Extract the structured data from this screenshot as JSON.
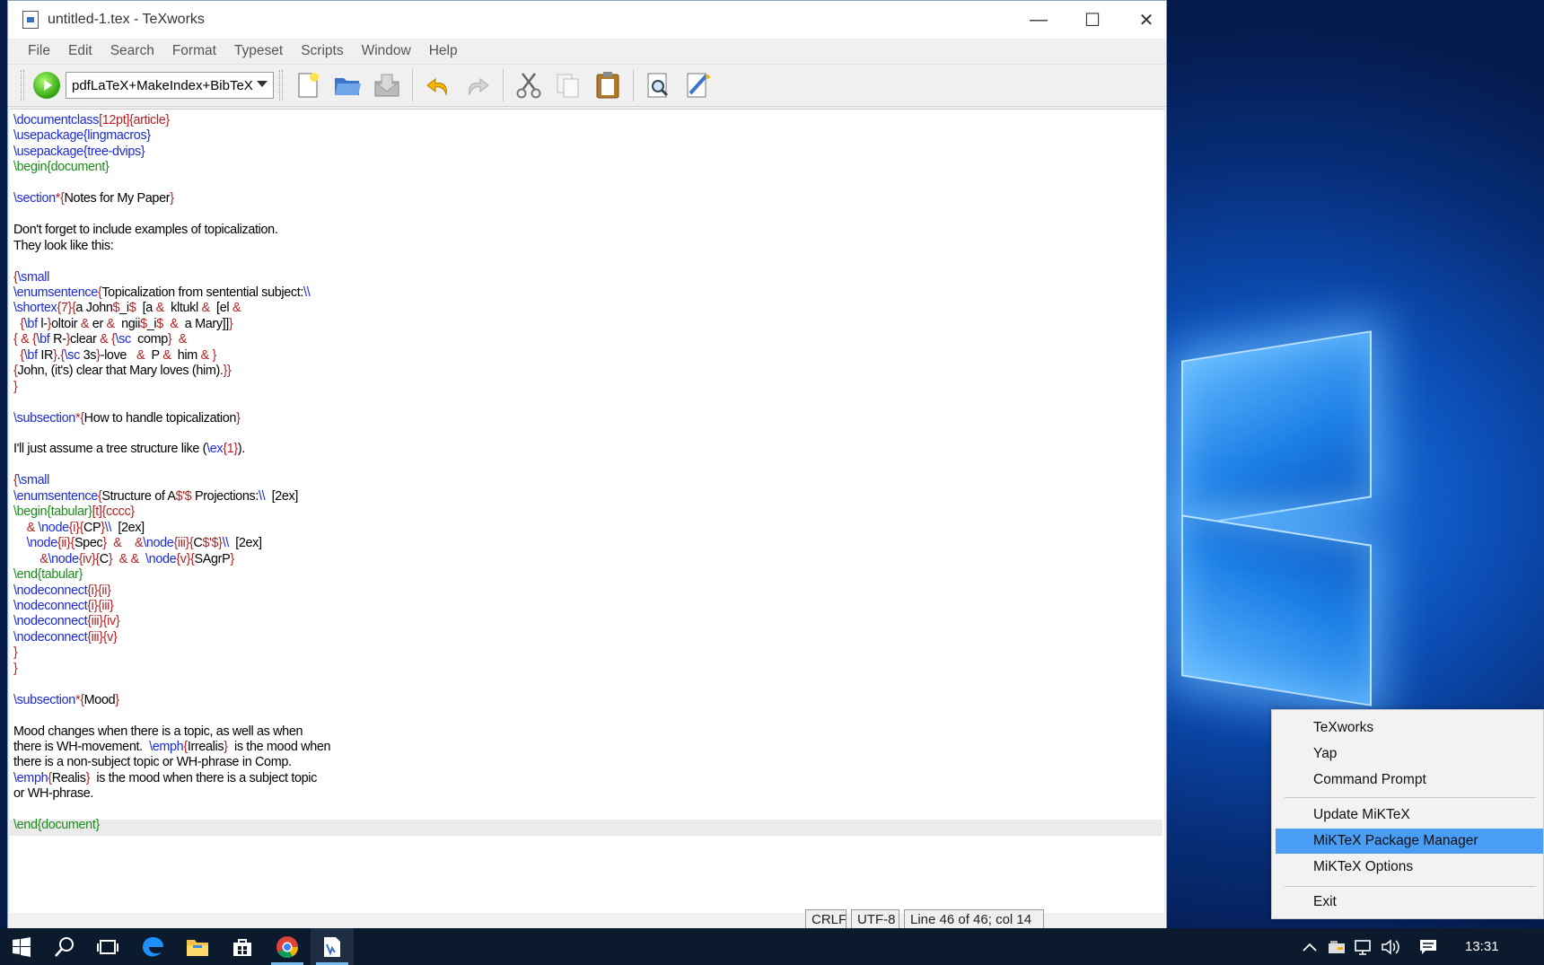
{
  "window": {
    "title": "untitled-1.tex - TeXworks",
    "controls": {
      "minimize": "—",
      "maximize": "☐",
      "close": "✕"
    }
  },
  "menubar": [
    "File",
    "Edit",
    "Search",
    "Format",
    "Typeset",
    "Scripts",
    "Window",
    "Help"
  ],
  "toolbar": {
    "engine": "pdfLaTeX+MakeIndex+BibTeX",
    "icons": [
      "new-file-icon",
      "open-folder-icon",
      "save-icon",
      "undo-icon",
      "redo-icon",
      "cut-icon",
      "copy-icon",
      "paste-icon",
      "find-icon",
      "replace-icon"
    ]
  },
  "editor": {
    "lines": [
      [
        [
          "b",
          "\\documentclass"
        ],
        [
          "r",
          "[12pt]{article}"
        ]
      ],
      [
        [
          "b",
          "\\usepackage"
        ],
        [
          "b",
          "{lingmacros}"
        ]
      ],
      [
        [
          "b",
          "\\usepackage"
        ],
        [
          "b",
          "{tree-dvips}"
        ]
      ],
      [
        [
          "g",
          "\\begin"
        ],
        [
          "g",
          "{document}"
        ]
      ],
      [],
      [
        [
          "b",
          "\\section"
        ],
        [
          "r",
          "*{"
        ],
        [
          "",
          "Notes for My Paper"
        ],
        [
          "r",
          "}"
        ]
      ],
      [],
      [
        [
          "",
          "Don't forget to include examples of topicalization."
        ]
      ],
      [
        [
          "",
          "They look like this:"
        ]
      ],
      [],
      [
        [
          "r",
          "{"
        ],
        [
          "b",
          "\\small"
        ]
      ],
      [
        [
          "b",
          "\\enumsentence"
        ],
        [
          "r",
          "{"
        ],
        [
          "",
          "Topicalization from sentential subject:"
        ],
        [
          "b",
          "\\\\"
        ]
      ],
      [
        [
          "b",
          "\\shortex"
        ],
        [
          "r",
          "{7}{"
        ],
        [
          "",
          "a John"
        ],
        [
          "r",
          "$"
        ],
        [
          "",
          "_i"
        ],
        [
          "r",
          "$"
        ],
        [
          "",
          "  [a "
        ],
        [
          "r",
          "&"
        ],
        [
          "",
          "  kltukl "
        ],
        [
          "r",
          "&"
        ],
        [
          "",
          "  [el "
        ],
        [
          "r",
          "&"
        ]
      ],
      [
        [
          "",
          "  "
        ],
        [
          "r",
          "{"
        ],
        [
          "b",
          "\\bf"
        ],
        [
          "",
          " l-"
        ],
        [
          "r",
          "}"
        ],
        [
          "",
          "oltoir "
        ],
        [
          "r",
          "&"
        ],
        [
          "",
          " er "
        ],
        [
          "r",
          "&"
        ],
        [
          "",
          "  ngii"
        ],
        [
          "r",
          "$"
        ],
        [
          "",
          "_i"
        ],
        [
          "r",
          "$"
        ],
        [
          "",
          "  "
        ],
        [
          "r",
          "&"
        ],
        [
          "",
          "  a Mary]]"
        ],
        [
          "r",
          "}"
        ]
      ],
      [
        [
          "r",
          "{ & {"
        ],
        [
          "b",
          "\\bf"
        ],
        [
          "",
          " R-"
        ],
        [
          "r",
          "}"
        ],
        [
          "",
          "clear "
        ],
        [
          "r",
          "& {"
        ],
        [
          "b",
          "\\sc"
        ],
        [
          "",
          "  comp"
        ],
        [
          "r",
          "}"
        ],
        [
          "",
          "  "
        ],
        [
          "r",
          "&"
        ]
      ],
      [
        [
          "",
          "  "
        ],
        [
          "r",
          "{"
        ],
        [
          "b",
          "\\bf"
        ],
        [
          "",
          " IR"
        ],
        [
          "r",
          "}"
        ],
        [
          "",
          "."
        ],
        [
          "r",
          "{"
        ],
        [
          "b",
          "\\sc"
        ],
        [
          "",
          " 3s"
        ],
        [
          "r",
          "}"
        ],
        [
          "",
          "-love   "
        ],
        [
          "r",
          "&"
        ],
        [
          "",
          "  P "
        ],
        [
          "r",
          "&"
        ],
        [
          "",
          "  him "
        ],
        [
          "r",
          "& }"
        ]
      ],
      [
        [
          "r",
          "{"
        ],
        [
          "",
          "John, (it's) clear that Mary loves (him)."
        ],
        [
          "r",
          "}}"
        ]
      ],
      [
        [
          "r",
          "}"
        ]
      ],
      [],
      [
        [
          "b",
          "\\subsection"
        ],
        [
          "r",
          "*{"
        ],
        [
          "",
          "How to handle topicalization"
        ],
        [
          "r",
          "}"
        ]
      ],
      [],
      [
        [
          "",
          "I'll just assume a tree structure like ("
        ],
        [
          "b",
          "\\ex"
        ],
        [
          "r",
          "{1}"
        ],
        [
          "",
          "). "
        ]
      ],
      [],
      [
        [
          "r",
          "{"
        ],
        [
          "b",
          "\\small"
        ]
      ],
      [
        [
          "b",
          "\\enumsentence"
        ],
        [
          "r",
          "{"
        ],
        [
          "",
          "Structure of A"
        ],
        [
          "r",
          "$'$"
        ],
        [
          "",
          " Projections:"
        ],
        [
          "b",
          "\\\\"
        ],
        [
          "",
          "  [2ex]"
        ]
      ],
      [
        [
          "g",
          "\\begin"
        ],
        [
          "g",
          "{tabular}"
        ],
        [
          "r",
          "[t]{cccc}"
        ]
      ],
      [
        [
          "",
          "    "
        ],
        [
          "r",
          "& "
        ],
        [
          "b",
          "\\node"
        ],
        [
          "r",
          "{i}{"
        ],
        [
          "",
          "CP"
        ],
        [
          "r",
          "}"
        ],
        [
          "b",
          "\\\\"
        ],
        [
          "",
          "  [2ex]"
        ]
      ],
      [
        [
          "",
          "    "
        ],
        [
          "b",
          "\\node"
        ],
        [
          "r",
          "{ii}{"
        ],
        [
          "",
          "Spec"
        ],
        [
          "r",
          "}"
        ],
        [
          "",
          "  "
        ],
        [
          "r",
          "&"
        ],
        [
          "",
          "    "
        ],
        [
          "r",
          "&"
        ],
        [
          "b",
          "\\node"
        ],
        [
          "r",
          "{iii}{"
        ],
        [
          "",
          "C"
        ],
        [
          "r",
          "$'$"
        ],
        [
          "r",
          "}"
        ],
        [
          "b",
          "\\\\"
        ],
        [
          "",
          "  [2ex]"
        ]
      ],
      [
        [
          "",
          "        "
        ],
        [
          "r",
          "&"
        ],
        [
          "b",
          "\\node"
        ],
        [
          "r",
          "{iv}{"
        ],
        [
          "",
          "C"
        ],
        [
          "r",
          "}"
        ],
        [
          "",
          "  "
        ],
        [
          "r",
          "& &"
        ],
        [
          "",
          "  "
        ],
        [
          "b",
          "\\node"
        ],
        [
          "r",
          "{v}{"
        ],
        [
          "",
          "SAgrP"
        ],
        [
          "r",
          "}"
        ]
      ],
      [
        [
          "g",
          "\\end"
        ],
        [
          "g",
          "{tabular}"
        ]
      ],
      [
        [
          "b",
          "\\nodeconnect"
        ],
        [
          "r",
          "{i}{ii}"
        ]
      ],
      [
        [
          "b",
          "\\nodeconnect"
        ],
        [
          "r",
          "{i}{iii}"
        ]
      ],
      [
        [
          "b",
          "\\nodeconnect"
        ],
        [
          "r",
          "{iii}{iv}"
        ]
      ],
      [
        [
          "b",
          "\\nodeconnect"
        ],
        [
          "r",
          "{iii}{v}"
        ]
      ],
      [
        [
          "r",
          "}"
        ]
      ],
      [
        [
          "r",
          "}"
        ]
      ],
      [],
      [
        [
          "b",
          "\\subsection"
        ],
        [
          "r",
          "*{"
        ],
        [
          "",
          "Mood"
        ],
        [
          "r",
          "}"
        ]
      ],
      [],
      [
        [
          "",
          "Mood changes when there is a topic, as well as when"
        ]
      ],
      [
        [
          "",
          "there is WH-movement.  "
        ],
        [
          "b",
          "\\emph"
        ],
        [
          "r",
          "{"
        ],
        [
          "",
          "Irrealis"
        ],
        [
          "r",
          "}"
        ],
        [
          "",
          "  is the mood when"
        ]
      ],
      [
        [
          "",
          "there is a non-subject topic or WH-phrase in Comp."
        ]
      ],
      [
        [
          "b",
          "\\emph"
        ],
        [
          "r",
          "{"
        ],
        [
          "",
          "Realis"
        ],
        [
          "r",
          "}"
        ],
        [
          "",
          "  is the mood when there is a subject topic"
        ]
      ],
      [
        [
          "",
          "or WH-phrase."
        ]
      ],
      [],
      [
        [
          "g",
          "\\end"
        ],
        [
          "g",
          "{document}"
        ]
      ]
    ]
  },
  "status": {
    "line_ending": "CRLF",
    "encoding": "UTF-8",
    "position": "Line 46 of 46; col 14"
  },
  "tray_menu": {
    "items": [
      "TeXworks",
      "Yap",
      "Command Prompt",
      "Update MiKTeX",
      "MiKTeX Package Manager",
      "MiKTeX Options",
      "Exit"
    ],
    "highlighted": "MiKTeX Package Manager"
  },
  "taskbar": {
    "time": "13:31"
  }
}
